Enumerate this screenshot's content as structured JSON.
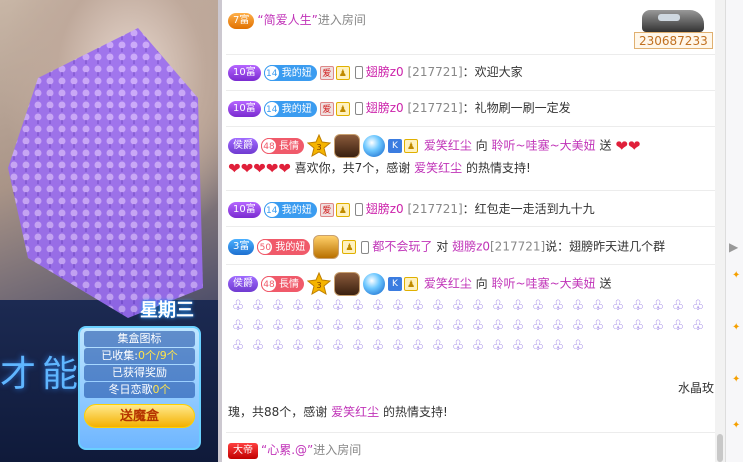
{
  "video": {
    "week_label": "星期三",
    "big_text": "才能",
    "panel": {
      "title": "集盒图标",
      "collected_prefix": "已收集:",
      "collected_value": "0个/9个",
      "reward_label": "已获得奖励",
      "song_prefix": "冬日恋歌",
      "song_value": "0个",
      "button": "送魔盒"
    }
  },
  "chat": {
    "messages": [
      {
        "id": "m1",
        "badge": "7富",
        "user": "“简爱人生”",
        "text": "进入房间",
        "score": "230687233"
      },
      {
        "id": "m2",
        "badge": "10富",
        "fan_level": "14",
        "fan_label": "我的妞",
        "user": "翅膀z0",
        "uid": "[217721]",
        "text": "：欢迎大家"
      },
      {
        "id": "m3",
        "badge": "10富",
        "fan_level": "14",
        "fan_label": "我的妞",
        "user": "翅膀z0",
        "uid": "[217721]",
        "text": "：礼物刷一刷一定发"
      },
      {
        "id": "m4",
        "badge": "侯爵",
        "fan_level": "48",
        "fan_label": "長情",
        "crown_level": "3",
        "user": "爱笑红尘",
        "to": "向",
        "target": "聆听~哇塞~大美妞",
        "send": "送",
        "text_a": "喜欢你，共7个，感谢",
        "thanks_user": "爱笑红尘",
        "text_b": "的热情支持!"
      },
      {
        "id": "m5",
        "badge": "10富",
        "fan_level": "14",
        "fan_label": "我的妞",
        "user": "翅膀z0",
        "uid": "[217721]",
        "text": "：红包走一走活到九十九"
      },
      {
        "id": "m6",
        "badge": "3富",
        "fan_level": "50",
        "fan_label": "我的妞",
        "user": "都不会玩了",
        "to": "对",
        "target": "翅膀z0",
        "uid": "[217721]",
        "text": "说：翅膀昨天进几个群"
      },
      {
        "id": "m7",
        "badge": "侯爵",
        "fan_level": "48",
        "fan_label": "長情",
        "crown_level": "3",
        "user": "爱笑红尘",
        "to": "向",
        "target": "聆听~哇塞~大美妞",
        "send": "送",
        "gift_tail": "水晶玫",
        "text_a": "瑰，共88个，感谢",
        "thanks_user": "爱笑红尘",
        "text_b": "的热情支持!"
      },
      {
        "id": "m8",
        "badge": "大帝",
        "user": "“心累.@”",
        "text": "进入房间"
      }
    ]
  },
  "colors": {
    "accent": "#c033b8",
    "fan": "#3b9cf0",
    "heart": "#e0203a"
  }
}
